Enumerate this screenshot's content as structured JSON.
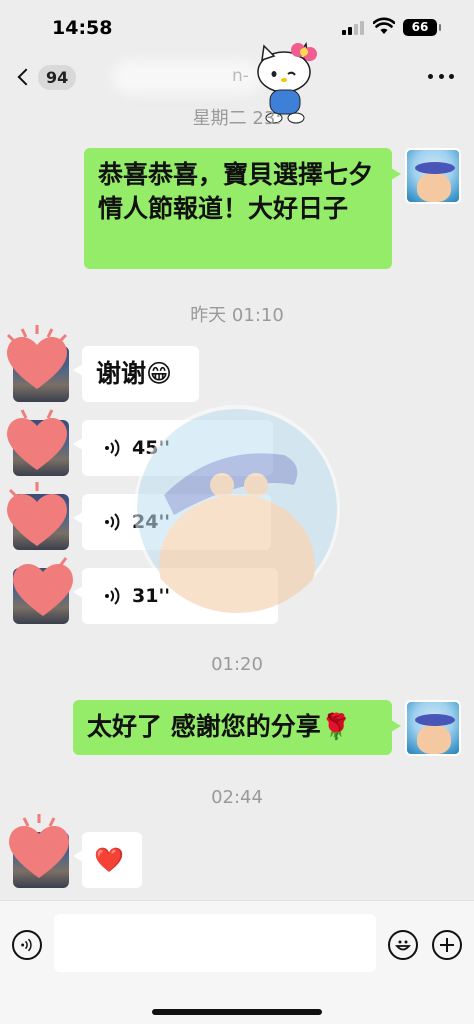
{
  "status_bar": {
    "time": "14:58",
    "battery": "66"
  },
  "nav": {
    "unread_count": "94",
    "contact_name_tail": "n-"
  },
  "messages": {
    "ts1": "星期二 23:",
    "msg1": "恭喜恭喜，寶貝選擇七夕情人節報道！大好日子",
    "ts2": "昨天 01:10",
    "msg2": "谢谢😁",
    "voice1": "45''",
    "voice2": "24''",
    "voice3": "31''",
    "ts3": "01:20",
    "msg3": "太好了 感謝您的分享🌹",
    "ts4": "02:44",
    "msg4": "❤️"
  },
  "input": {
    "placeholder": ""
  },
  "colors": {
    "background": "#ededed",
    "bubble_self": "#95ec69",
    "bubble_other": "#ffffff",
    "heart": "#f07c7c"
  }
}
